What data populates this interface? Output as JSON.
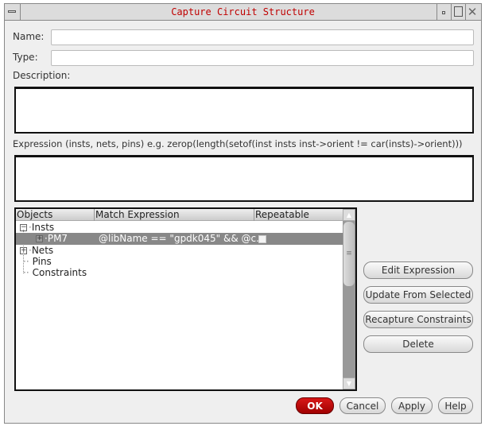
{
  "window": {
    "title": "Capture Circuit Structure"
  },
  "form": {
    "name_label": "Name:",
    "name_value": "",
    "type_label": "Type:",
    "type_value": "",
    "description_label": "Description:",
    "description_value": "",
    "expression_label": "Expression (insts, nets, pins) e.g. zerop(length(setof(inst insts inst->orient != car(insts)->orient)))",
    "expression_value": ""
  },
  "tree": {
    "columns": [
      "Objects",
      "Match Expression",
      "Repeatable"
    ],
    "rows": [
      {
        "object": "Insts",
        "expr": "",
        "expander": "minus"
      },
      {
        "object": "PM7",
        "expr": "@libName == \"gpdk045\" && @c...",
        "expander": "plus",
        "repeatable": false,
        "selected": true
      },
      {
        "object": "Nets",
        "expr": "",
        "expander": "plus"
      },
      {
        "object": "Pins",
        "expr": ""
      },
      {
        "object": "Constraints",
        "expr": ""
      }
    ]
  },
  "side_buttons": [
    "Edit Expression",
    "Update From Selected",
    "Recapture Constraints",
    "Delete"
  ],
  "footer": {
    "ok": "OK",
    "cancel": "Cancel",
    "apply": "Apply",
    "help": "Help"
  }
}
